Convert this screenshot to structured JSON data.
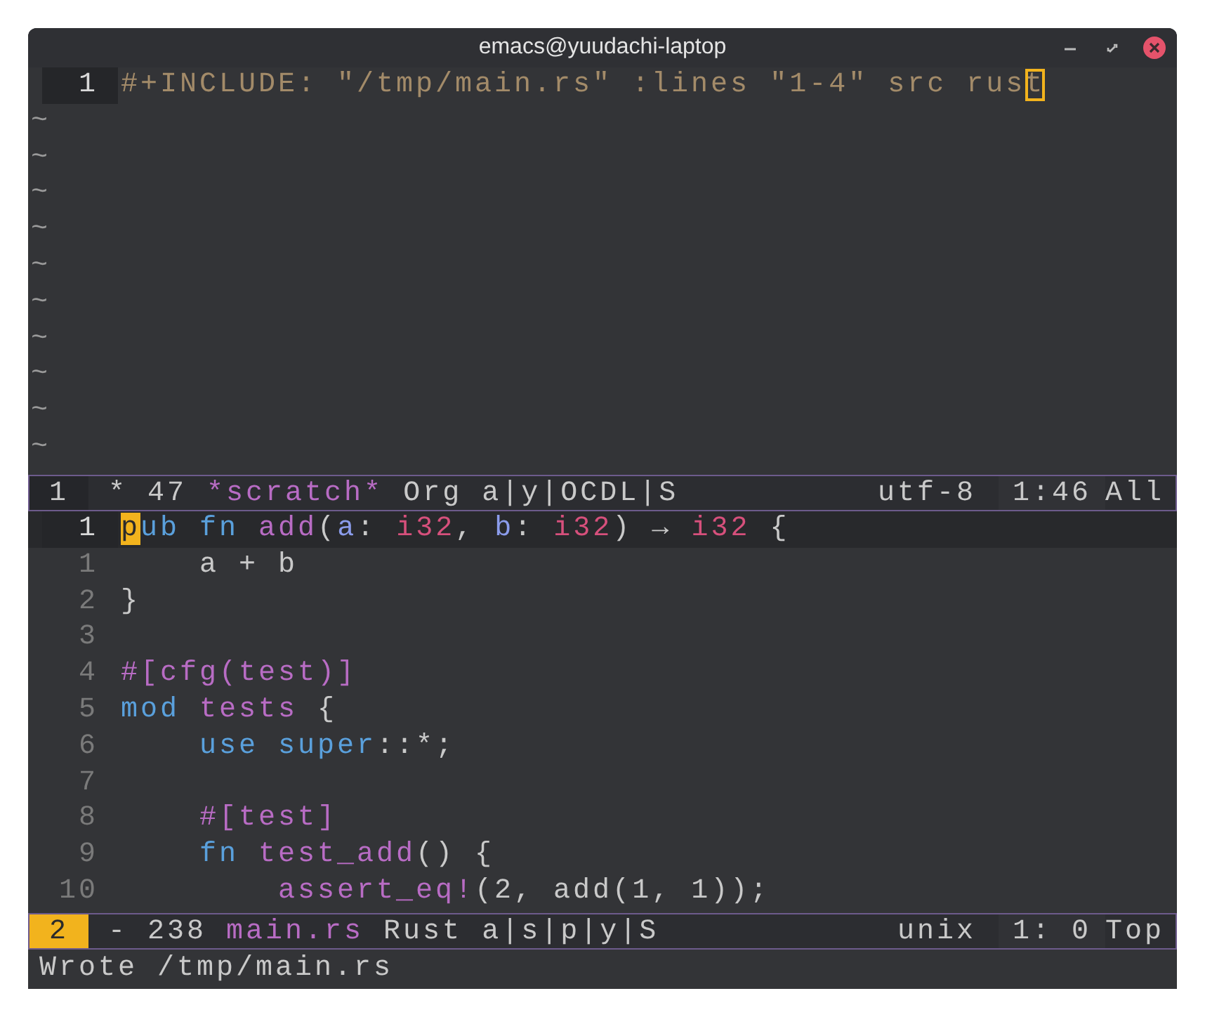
{
  "window": {
    "title": "emacs@yuudachi-laptop"
  },
  "panes": [
    {
      "active": false,
      "lines": [
        {
          "number": "1",
          "current": true,
          "segments": [
            {
              "text": "#+INCLUDE: \"/tmp/main.rs\" :lines \"1-4\" src rus",
              "kind": "org"
            },
            {
              "text": "t",
              "kind": "cursor-box"
            }
          ]
        }
      ],
      "empty_markers": [
        "~",
        "~",
        "~",
        "~",
        "~",
        "~",
        "~",
        "~",
        "~",
        "~"
      ],
      "mode_line": {
        "window_number": "1",
        "state": "*",
        "size": "47",
        "buffer": "*scratch*",
        "mode": "Org",
        "flags": "a|y|OCDL|S",
        "encoding": "utf-8",
        "position": "1:46",
        "scroll": "All"
      }
    },
    {
      "active": true,
      "lines": [
        {
          "number": "1",
          "current": true,
          "segments": [
            {
              "text": "p",
              "kind": "cursor-block"
            },
            {
              "text": "ub fn ",
              "kind": "keyword"
            },
            {
              "text": "add",
              "kind": "function"
            },
            {
              "text": "(",
              "kind": "plain"
            },
            {
              "text": "a",
              "kind": "variable"
            },
            {
              "text": ": ",
              "kind": "plain"
            },
            {
              "text": "i32",
              "kind": "type"
            },
            {
              "text": ", ",
              "kind": "plain"
            },
            {
              "text": "b",
              "kind": "variable"
            },
            {
              "text": ": ",
              "kind": "plain"
            },
            {
              "text": "i32",
              "kind": "type"
            },
            {
              "text": ") → ",
              "kind": "plain"
            },
            {
              "text": "i32",
              "kind": "type"
            },
            {
              "text": " {",
              "kind": "plain"
            }
          ]
        },
        {
          "number": "1",
          "current": false,
          "segments": [
            {
              "text": "    a + b",
              "kind": "plain"
            }
          ]
        },
        {
          "number": "2",
          "current": false,
          "segments": [
            {
              "text": "}",
              "kind": "plain"
            }
          ]
        },
        {
          "number": "3",
          "current": false
        },
        {
          "number": "4",
          "current": false,
          "segments": [
            {
              "text": "#[cfg(test)]",
              "kind": "function"
            }
          ]
        },
        {
          "number": "5",
          "current": false,
          "segments": [
            {
              "text": "mod ",
              "kind": "keyword"
            },
            {
              "text": "tests",
              "kind": "function"
            },
            {
              "text": " {",
              "kind": "plain"
            }
          ]
        },
        {
          "number": "6",
          "current": false,
          "segments": [
            {
              "text": "    use super",
              "kind": "keyword"
            },
            {
              "text": "::*;",
              "kind": "plain"
            }
          ]
        },
        {
          "number": "7",
          "current": false
        },
        {
          "number": "8",
          "current": false,
          "segments": [
            {
              "text": "    #[test]",
              "kind": "function"
            }
          ]
        },
        {
          "number": "9",
          "current": false,
          "segments": [
            {
              "text": "    fn ",
              "kind": "keyword"
            },
            {
              "text": "test_add",
              "kind": "function"
            },
            {
              "text": "() {",
              "kind": "plain"
            }
          ]
        },
        {
          "number": "10",
          "current": false,
          "segments": [
            {
              "text": "        assert_eq!",
              "kind": "function"
            },
            {
              "text": "(2, add(1, 1));",
              "kind": "plain"
            }
          ]
        }
      ],
      "mode_line": {
        "window_number": "2",
        "state": "-",
        "size": "238",
        "buffer": "main.rs",
        "mode": "Rust",
        "flags": "a|s|p|y|S",
        "encoding": "unix",
        "position": "1: 0",
        "scroll": "Top"
      }
    }
  ],
  "echo_area": "Wrote /tmp/main.rs"
}
